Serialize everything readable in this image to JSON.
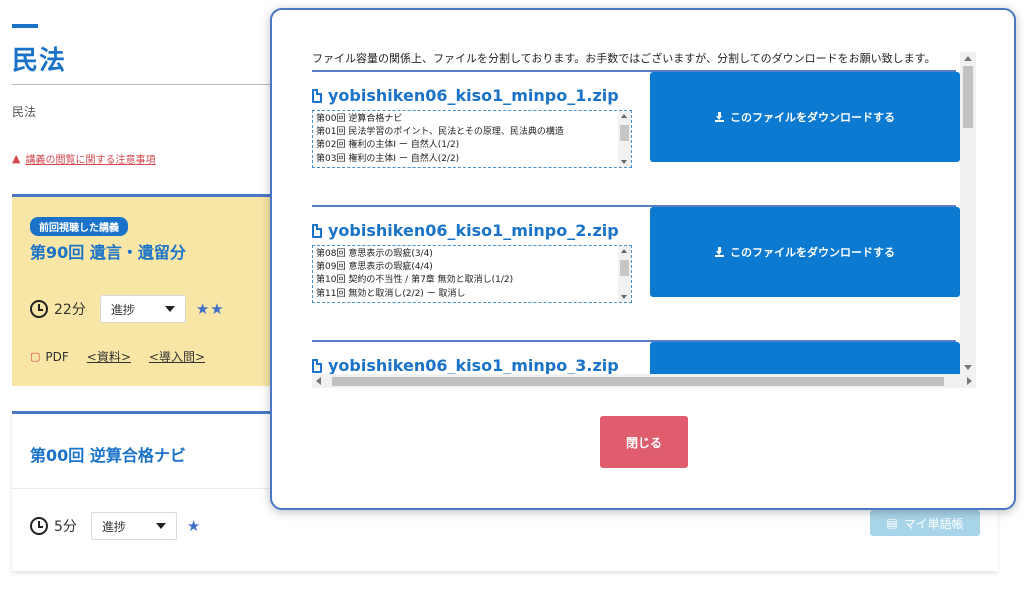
{
  "page": {
    "title": "民法",
    "subtitle": "民法",
    "notice": "講義の閲覧に関する注意事項"
  },
  "last_lecture": {
    "badge": "前回視聴した講義",
    "title": "第90回 遺言・遺留分",
    "duration": "22分",
    "progress_label": "進捗",
    "stars": "★★",
    "pdf_label": "PDF",
    "link_material": "<資料>",
    "link_intro": "<導入問>"
  },
  "lecture_00": {
    "title": "第00回 逆算合格ナビ",
    "duration": "5分",
    "progress_label": "進捗",
    "stars": "★",
    "vocab_label": "マイ単語帳"
  },
  "modal": {
    "intro": "ファイル容量の関係上、ファイルを分割しております。お手数ではございますが、分割してのダウンロードをお願い致します。",
    "download_label": "このファイルをダウンロードする",
    "close_label": "閉じる",
    "files": [
      {
        "name": "yobishiken06_kiso1_minpo_1.zip",
        "contents": [
          "第00回 逆算合格ナビ",
          "第01回 民法学習のポイント、民法とその原理、民法典の構造",
          "第02回 権利の主体Ⅰ ー 自然人(1/2)",
          "第03回 権利の主体Ⅰ ー 自然人(2/2)"
        ]
      },
      {
        "name": "yobishiken06_kiso1_minpo_2.zip",
        "contents": [
          "第08回 意思表示の瑕疵(3/4)",
          "第09回 意思表示の瑕疵(4/4)",
          "第10回 契約の不当性 / 第7章 無効と取消し(1/2)",
          "第11回 無効と取消し(2/2) ー 取消し"
        ]
      },
      {
        "name": "yobishiken06_kiso1_minpo_3.zip",
        "contents": []
      }
    ]
  },
  "colors": {
    "brand": "#1a73c8",
    "download": "#0c7ad1",
    "close": "#e05d6e",
    "highlight_card": "#f8e6a6"
  }
}
